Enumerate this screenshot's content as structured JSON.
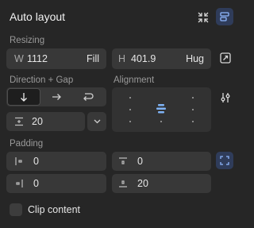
{
  "panel": {
    "title": "Auto layout"
  },
  "icons": {
    "collapse": "collapse-arrows-icon",
    "layout_toggle": "auto-layout-icon",
    "resize_to_fit": "resize-icon",
    "alignment_settings": "sliders-icon",
    "padding_individual": "padding-individual-icon"
  },
  "resizing": {
    "label": "Resizing",
    "width": {
      "prefix": "W",
      "value": "1112",
      "mode": "Fill"
    },
    "height": {
      "prefix": "H",
      "value": "401.9",
      "mode": "Hug"
    }
  },
  "direction": {
    "label": "Direction + Gap",
    "options": [
      "vertical",
      "horizontal",
      "wrap"
    ],
    "selected": "vertical",
    "gap": "20"
  },
  "alignment": {
    "label": "Alignment",
    "selected": "top-center"
  },
  "padding": {
    "label": "Padding",
    "left": "0",
    "top": "0",
    "right": "0",
    "bottom": "20"
  },
  "clip_content": {
    "label": "Clip content",
    "checked": false
  },
  "colors": {
    "background": "#262626",
    "field": "#383838",
    "selected_segment": "#4a4a4a",
    "accent": "#7fb3f5",
    "active_button_bg": "#2f3c5a"
  }
}
